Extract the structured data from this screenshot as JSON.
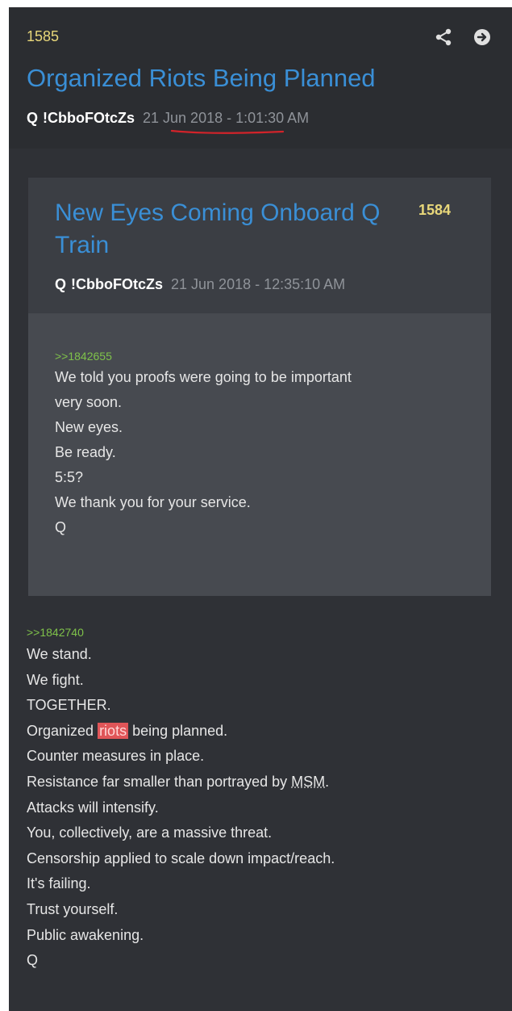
{
  "post": {
    "number": "1585",
    "title": "Organized Riots Being Planned",
    "author": "Q",
    "tripcode": "!CbboFOtcZs",
    "date": "21 Jun 2018",
    "time": " - 1:01:30 AM",
    "icons": {
      "share": "share-icon",
      "goto": "arrow-circle-right-icon"
    }
  },
  "quoted_post": {
    "title": "New Eyes Coming Onboard Q Train",
    "number": "1584",
    "author": "Q",
    "tripcode": "!CbboFOtcZs",
    "datetime": "21 Jun 2018 - 12:35:10 AM",
    "reply_link": ">>1842655",
    "lines": [
      "We told you proofs were going to be important",
      "very soon.",
      "New eyes.",
      "Be ready.",
      "5:5?",
      "We thank you for your service.",
      "Q"
    ]
  },
  "body": {
    "reply_link": ">>1842740",
    "lines": [
      "We stand.",
      "We fight.",
      "TOGETHER."
    ],
    "riots_line": {
      "before": "Organized ",
      "highlight": "riots",
      "after": " being planned."
    },
    "line_counter": "Counter measures in place.",
    "msm_line": {
      "before": "Resistance far smaller than portrayed by ",
      "underlined": "MSM",
      "after": "."
    },
    "lines_after": [
      "Attacks will intensify.",
      "You, collectively, are a massive threat.",
      "Censorship applied to scale down impact/reach.",
      "It's failing.",
      "Trust yourself.",
      "Public awakening.",
      "Q"
    ]
  },
  "colors": {
    "background": "#2b2d31",
    "title_blue": "#3a8fd6",
    "number_yellow": "#e8d77a",
    "reply_green": "#7fc24a",
    "highlight_red": "#e05558"
  }
}
